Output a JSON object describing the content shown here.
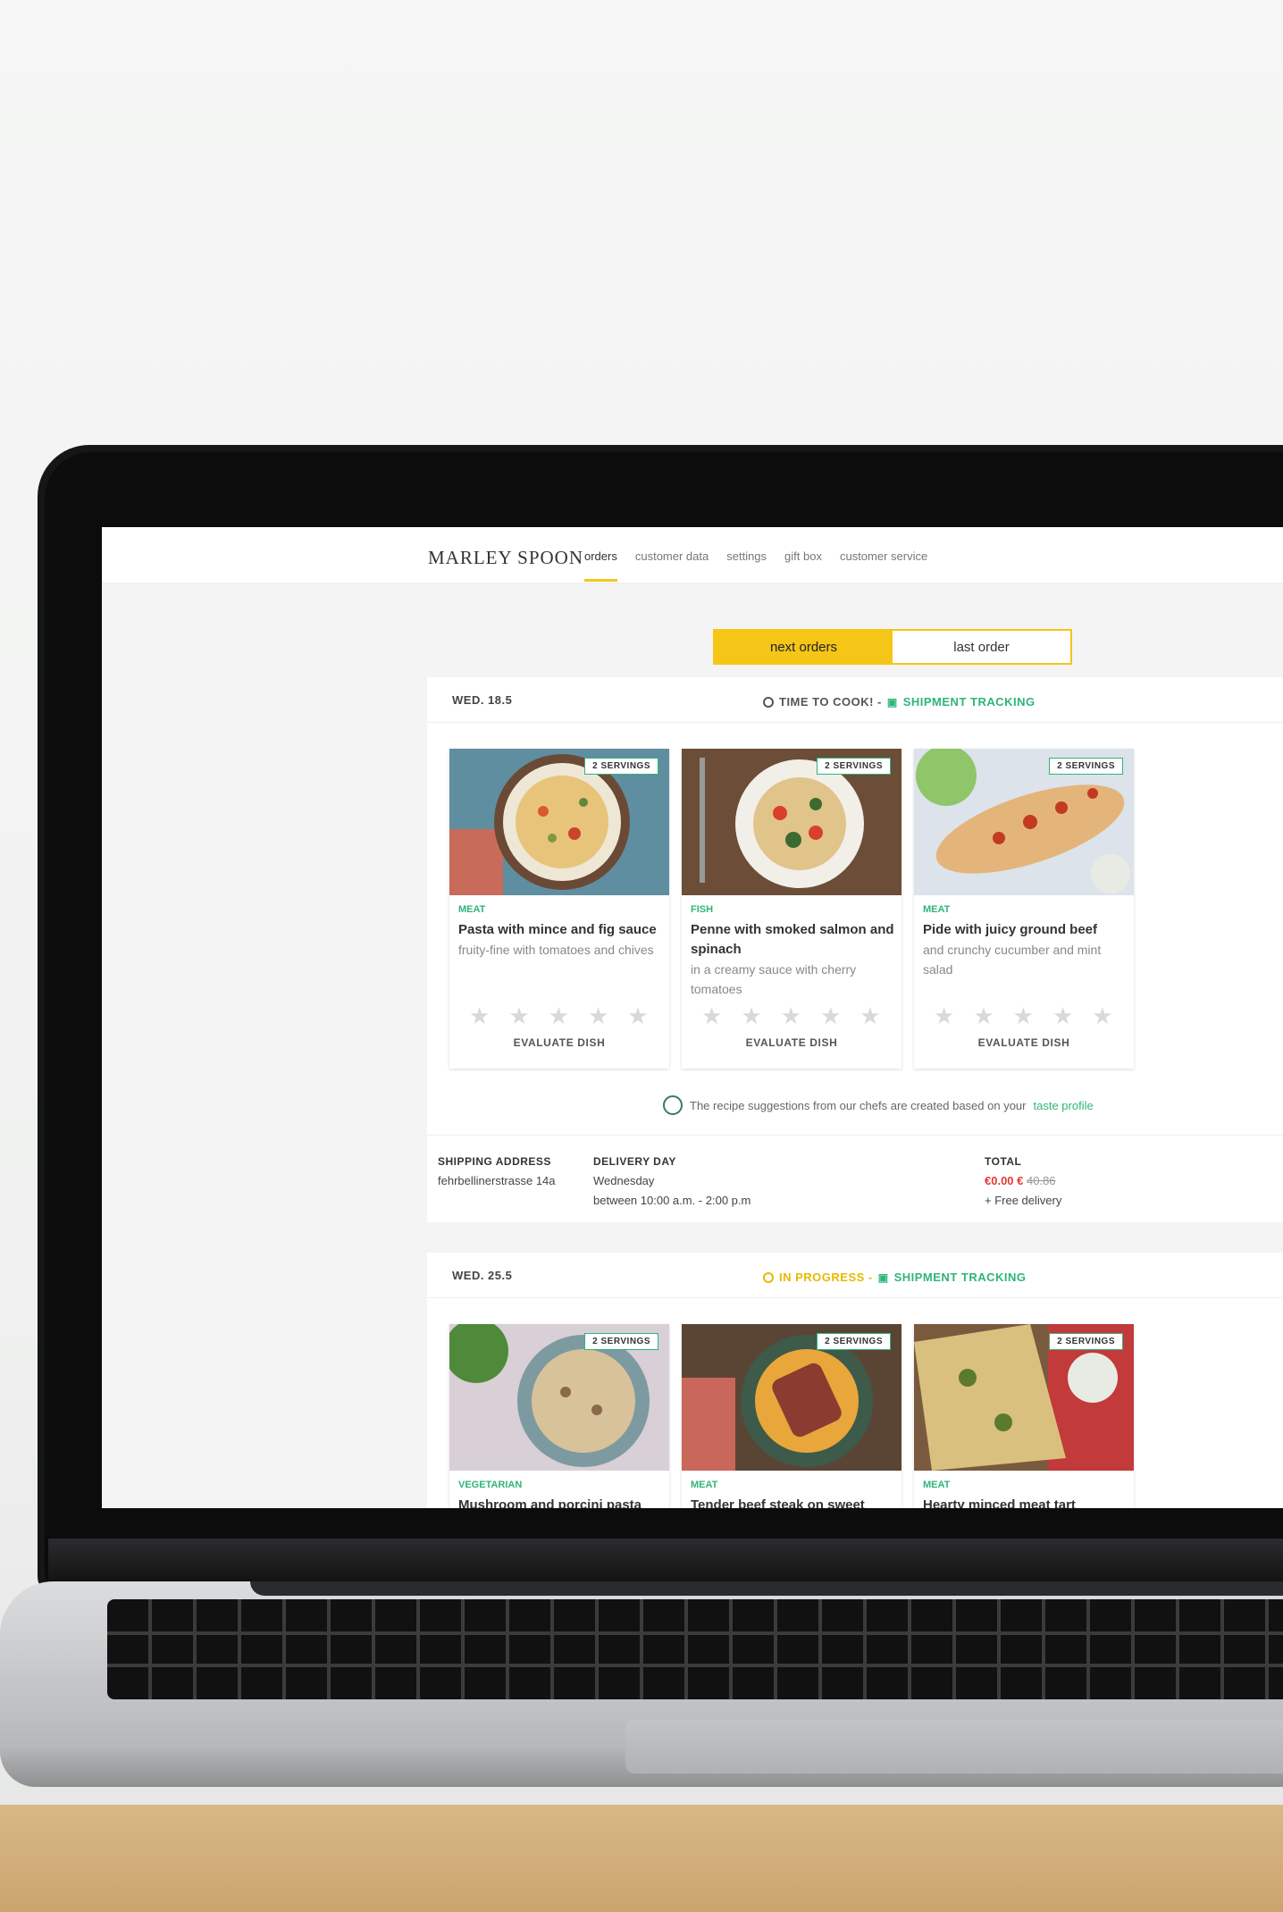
{
  "brand": {
    "logo": "MARLEY SPOON"
  },
  "nav": {
    "items": [
      "orders",
      "customer data",
      "settings",
      "gift box",
      "customer service"
    ]
  },
  "toggle": {
    "next": "next orders",
    "last": "last order"
  },
  "orders": [
    {
      "date": "WED. 18.5",
      "status": "TIME TO COOK! -",
      "tracking": "SHIPMENT TRACKING",
      "cards": [
        {
          "servings": "2 SERVINGS",
          "category": "MEAT",
          "title": "Pasta with mince and fig sauce",
          "subtitle": "fruity-fine with tomatoes and chives"
        },
        {
          "servings": "2 SERVINGS",
          "category": "FISH",
          "title": "Penne with smoked salmon and spinach",
          "subtitle": "in a creamy sauce with cherry tomatoes"
        },
        {
          "servings": "2 SERVINGS",
          "category": "MEAT",
          "title": "Pide with juicy ground beef",
          "subtitle": "and crunchy cucumber and mint salad"
        }
      ],
      "stars": [
        "★",
        "★",
        "★",
        "★",
        "★"
      ],
      "evaluate": "EVALUATE DISH",
      "note": {
        "text": "The recipe suggestions from our chefs are created based on your",
        "link": "taste profile"
      },
      "shipping": {
        "label": "SHIPPING ADDRESS",
        "value": "fehrbellinerstrasse 14a"
      },
      "delivery": {
        "label": "DELIVERY DAY",
        "day": "Wednesday",
        "window": "between 10:00 a.m. - 2:00 p.m"
      },
      "total": {
        "label": "TOTAL",
        "price": "€0.00 €",
        "old_price": "40.86",
        "delivery": "+ Free delivery"
      }
    },
    {
      "date": "WED. 25.5",
      "status": "IN PROGRESS -",
      "tracking": "SHIPMENT TRACKING",
      "cards": [
        {
          "servings": "2 SERVINGS",
          "category": "VEGETARIAN",
          "title": "Mushroom and porcini pasta"
        },
        {
          "servings": "2 SERVINGS",
          "category": "MEAT",
          "title": "Tender beef steak on sweet"
        },
        {
          "servings": "2 SERVINGS",
          "category": "MEAT",
          "title": "Hearty minced meat tart"
        }
      ]
    }
  ]
}
